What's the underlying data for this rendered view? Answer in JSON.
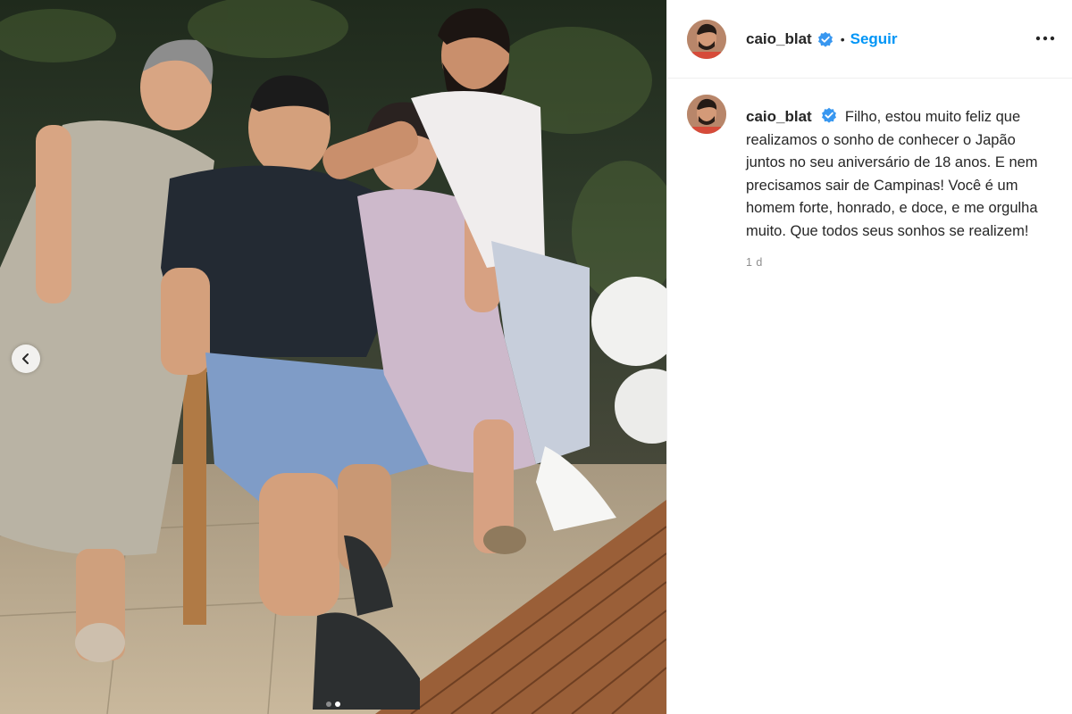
{
  "post": {
    "username": "caio_blat",
    "follow_label": "Seguir",
    "separator": "•",
    "caption": "Filho, estou muito feliz que realizamos o sonho de conhecer o Japão juntos no seu aniversário de 18 anos. E nem precisamos sair de Campinas! Você é um homem forte, honrado, e doce, e me orgulha muito. Que todos seus sonhos se realizem!",
    "timestamp": "1 d"
  },
  "media": {
    "carousel_total": 2,
    "carousel_active": 2
  },
  "icons": {
    "verified": "verified-badge-icon",
    "more": "more-options-icon",
    "prev": "chevron-left-icon"
  },
  "colors": {
    "accent": "#0095f6",
    "verified": "#3897f0",
    "text": "#262626",
    "muted": "#8e8e8e",
    "divider": "#efefef"
  }
}
